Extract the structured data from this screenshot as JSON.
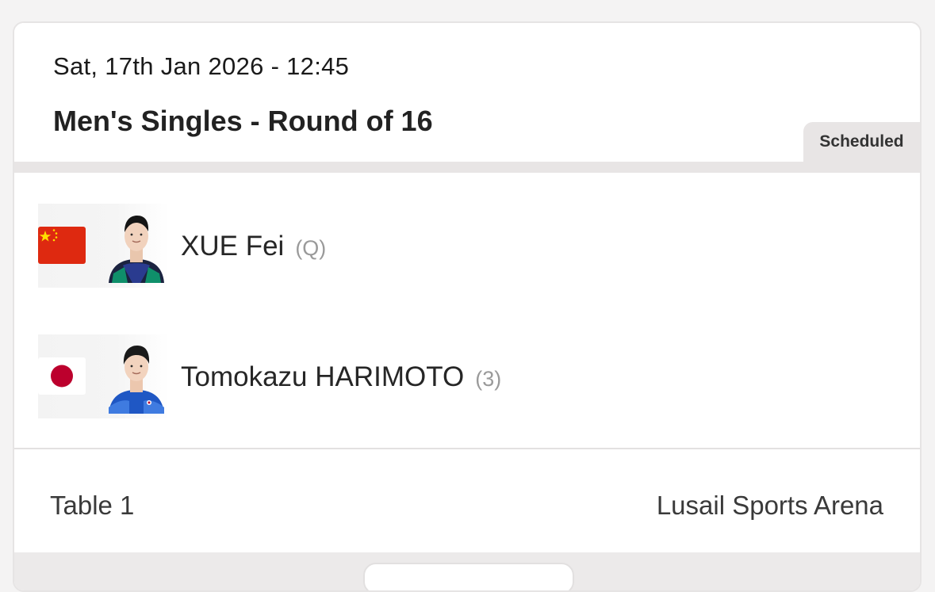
{
  "match": {
    "datetime": "Sat, 17th Jan 2026 - 12:45",
    "title": "Men's Singles - Round of 16",
    "status": "Scheduled"
  },
  "players": [
    {
      "name": "XUE Fei",
      "seed": "(Q)",
      "flag_icon": "china-flag-icon",
      "flag_color": "#de2910"
    },
    {
      "name": "Tomokazu HARIMOTO",
      "seed": "(3)",
      "flag_icon": "japan-flag-icon",
      "flag_color": "#bc002d"
    }
  ],
  "footer": {
    "table": "Table 1",
    "venue": "Lusail Sports Arena"
  },
  "colors": {
    "badge_bg": "#e8e5e5",
    "seed_text": "#9a9a9a"
  }
}
